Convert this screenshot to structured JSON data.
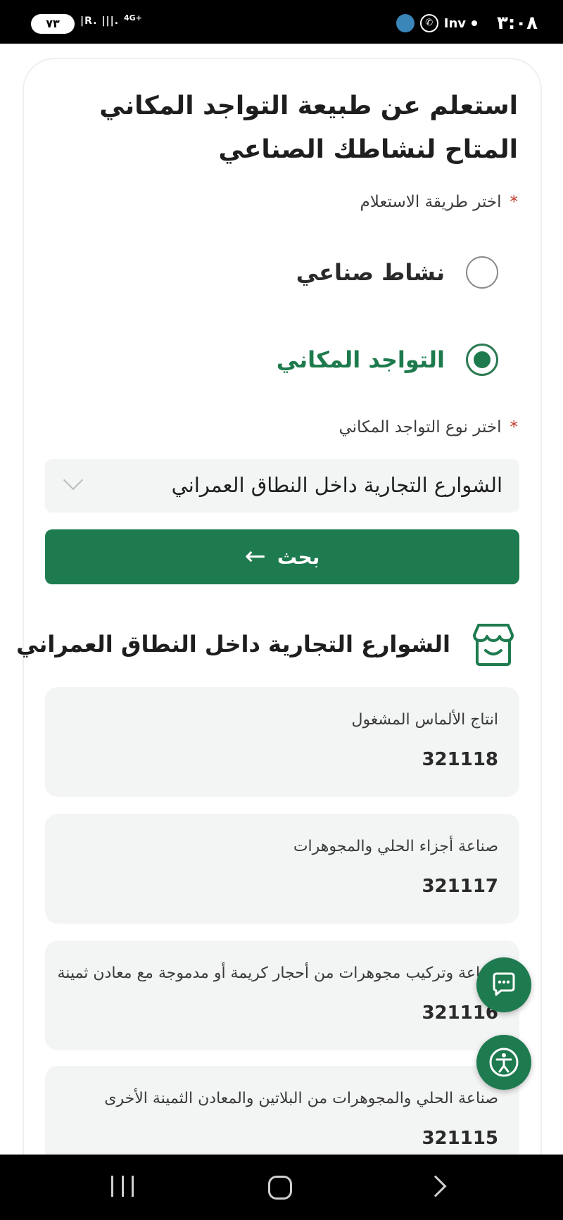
{
  "status_bar": {
    "time": "٣:٠٨",
    "inv": "Inv",
    "battery": "٧٣",
    "network": "4G+",
    "signal": "R"
  },
  "page": {
    "title": "استعلم عن طبيعة التواجد المكاني المتاح لنشاطك الصناعي"
  },
  "inquiry_method": {
    "label": "اختر طريقة الاستعلام",
    "required_mark": "*",
    "options": [
      {
        "label": "نشاط صناعي",
        "selected": false
      },
      {
        "label": "التواجد المكاني",
        "selected": true
      }
    ]
  },
  "location_type": {
    "label": "اختر نوع التواجد المكاني",
    "required_mark": "*",
    "selected_value": "الشوارع التجارية داخل النطاق العمراني"
  },
  "search_button": {
    "label": "بحث",
    "icon": "arrow-left-icon"
  },
  "results": {
    "title": "الشوارع التجارية داخل النطاق العمراني",
    "icon": "storefront-icon",
    "items": [
      {
        "name": "انتاج الألماس المشغول",
        "code": "321118"
      },
      {
        "name": "صناعة أجزاء الحلي والمجوهرات",
        "code": "321117"
      },
      {
        "name": "صناعة وتركيب مجوهرات من أحجار كريمة أو مدموجة مع معادن ثمينة",
        "code": "321116"
      },
      {
        "name": "صناعة الحلي والمجوهرات من البلاتين والمعادن الثمينة الأخرى",
        "code": "321115"
      }
    ]
  },
  "fabs": {
    "chat_icon": "chat-icon",
    "accessibility_icon": "accessibility-icon"
  },
  "colors": {
    "primary": "#1e7b4f",
    "card_bg": "#f3f4f4",
    "required": "#c0392b"
  }
}
